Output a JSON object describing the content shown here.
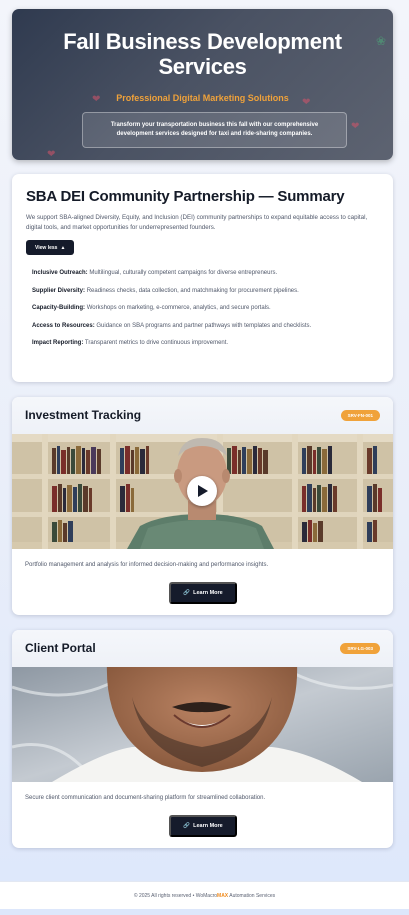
{
  "hero": {
    "title": "Fall Business Development Services",
    "subtitle": "Professional Digital Marketing Solutions",
    "description": "Transform your transportation business this fall with our comprehensive development services designed for taxi and ride-sharing companies."
  },
  "summary": {
    "title": "SBA DEI Community Partnership — Summary",
    "intro": "We support SBA-aligned Diversity, Equity, and Inclusion (DEI) community partnerships to expand equitable access to capital, digital tools, and market opportunities for underrepresented founders.",
    "toggle_label": "View less",
    "items": [
      {
        "label": "Inclusive Outreach:",
        "text": "Multilingual, culturally competent campaigns for diverse entrepreneurs."
      },
      {
        "label": "Supplier Diversity:",
        "text": "Readiness checks, data collection, and matchmaking for procurement pipelines."
      },
      {
        "label": "Capacity-Building:",
        "text": "Workshops on marketing, e-commerce, analytics, and secure portals."
      },
      {
        "label": "Access to Resources:",
        "text": "Guidance on SBA programs and partner pathways with templates and checklists."
      },
      {
        "label": "Impact Reporting:",
        "text": "Transparent metrics to drive continuous improvement."
      }
    ]
  },
  "services": [
    {
      "title": "Investment Tracking",
      "code": "SRV-FN-001",
      "description": "Portfolio management and analysis for informed decision-making and performance insights.",
      "button_label": "Learn More",
      "media": "video"
    },
    {
      "title": "Client Portal",
      "code": "SRV-LG-003",
      "description": "Secure client communication and document-sharing platform for streamlined collaboration.",
      "button_label": "Learn More",
      "media": "image"
    }
  ],
  "footer": {
    "prefix": "© 2025 All rights reserved • WoMacro",
    "brand_highlight": "MAX",
    "suffix": " Automation Services"
  },
  "colors": {
    "accent": "#f0a23a",
    "dark": "#151b2b",
    "hero_bg": "#3a4356"
  },
  "icons": {
    "toggle": "chevron-up-icon",
    "button": "link-icon",
    "media": "play-icon"
  }
}
